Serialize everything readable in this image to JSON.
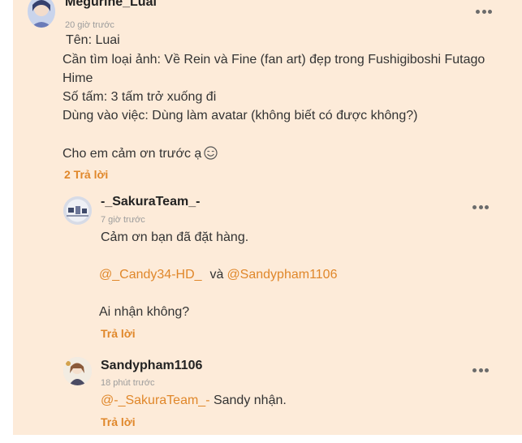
{
  "comment": {
    "username": "Megurine_Luai",
    "time": "20 giờ trước",
    "lines": [
      "Tên: Luai",
      "Cần tìm loại ảnh: Về Rein và Fine (fan art) đẹp trong Fushigiboshi Futago",
      "Hime",
      "Số tấm: 3 tấm trở xuống đi",
      "Dùng vào việc: Dùng làm avatar (không biết có được không?)",
      "Cho em cảm ơn trước ạ"
    ],
    "emoji_icon": "smiling-face-icon",
    "replies_label": "2 Trả lời"
  },
  "replies": [
    {
      "username": "-_SakuraTeam_-",
      "time": "7 giờ trước",
      "line1": "Cảm ơn bạn đã đặt hàng.",
      "mention1": "@_Candy34-HD_",
      "joiner": "và",
      "mention2": "@Sandypham1106",
      "line3": "Ai nhận không?",
      "reply_label": "Trả lời"
    },
    {
      "username": "Sandypham1106",
      "time": "18 phút trước",
      "mention": "@-_SakuraTeam_-",
      "text": " Sandy nhận.",
      "reply_label": "Trả lời"
    }
  ],
  "icons": {
    "more": "more-options-icon"
  },
  "colors": {
    "background": "#fdebd9",
    "accent": "#e0872a",
    "text": "#333333",
    "muted": "#9c9c9c"
  }
}
